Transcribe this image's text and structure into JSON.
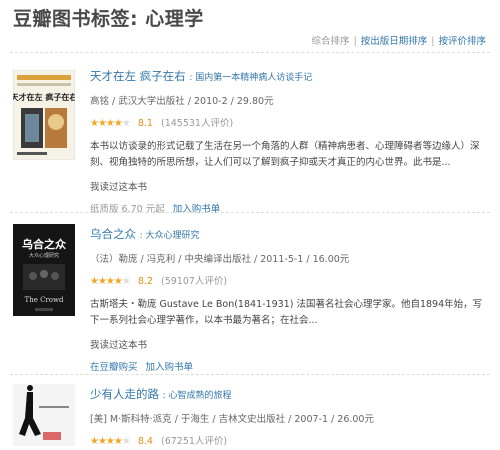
{
  "page_title": "豆瓣图书标签: 心理学",
  "sort": {
    "current": "综合排序",
    "by_date": "按出版日期排序",
    "by_rating": "按评价排序"
  },
  "books": [
    {
      "title": "天才在左 疯子在右",
      "subtitle": ": 国内第一本精神病人访谈手记",
      "pub": "高铭 / 武汉大学出版社 / 2010-2 / 29.80元",
      "stars_full": "★★★★",
      "stars_empty": "★",
      "score": "8.1",
      "votes": "(145531人评价)",
      "intro": "本书以访谈录的形式记载了生活在另一个角落的人群（精神病患者、心理障碍者等边缘人）深刻、视角独特的所思所想，让人们可以了解到疯子抑或天才真正的内心世界。此书是...",
      "read_label": "我读过这本书",
      "price_label": "纸质版 6.70 元起",
      "cart_label": "加入购书单",
      "cover_text": "天才在左 疯子在右"
    },
    {
      "title": "乌合之众",
      "subtitle": ": 大众心理研究",
      "pub": "（法）勒庞 / 冯克利 / 中央编译出版社 / 2011-5-1 / 16.00元",
      "stars_full": "★★★★",
      "stars_empty": "★",
      "score": "8.2",
      "votes": "(59107人评价)",
      "intro": "古斯塔夫・勒庞 Gustave Le Bon(1841-1931) 法国著名社会心理学家。他自1894年始，写下一系列社会心理学著作，以本书最为著名；在社会...",
      "read_label": "我读过这本书",
      "buy_douban": "在豆瓣购买",
      "cart_label": "加入购书单",
      "cover_text": "乌合之众",
      "cover_sub": "大众心理研究",
      "cover_en": "The Crowd"
    },
    {
      "title": "少有人走的路",
      "subtitle": ": 心智成熟的旅程",
      "pub": "[美] M·斯科特·派克 / 于海生 / 吉林文史出版社 / 2007-1 / 26.00元",
      "stars_full": "★★★★",
      "stars_empty": "★",
      "score": "8.4",
      "votes": "(67251人评价)"
    }
  ],
  "colors": {
    "link": "#3377aa",
    "star": "#f5a623",
    "title": "#494949"
  }
}
